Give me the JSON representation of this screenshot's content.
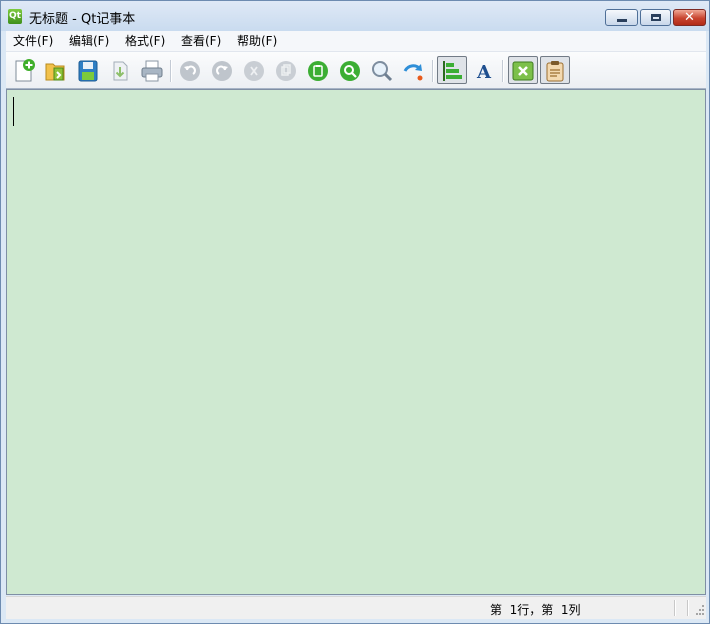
{
  "window": {
    "title": "无标题 - Qt记事本",
    "app_icon_letter": "Qt",
    "buttons": {
      "minimize": "minimize-icon",
      "maximize": "maximize-icon",
      "close": "close-icon",
      "close_glyph": "✕"
    }
  },
  "menu": {
    "items": [
      "文件(F)",
      "编辑(F)",
      "格式(F)",
      "查看(F)",
      "帮助(F)"
    ]
  },
  "toolbar": {
    "icons": [
      "new-file-icon",
      "open-file-icon",
      "save-icon",
      "save-as-icon",
      "print-icon",
      "undo-icon",
      "redo-icon",
      "cut-icon",
      "copy-icon",
      "paste-icon",
      "find-icon",
      "zoom-icon",
      "goto-icon",
      "align-toggle-icon",
      "font-icon",
      "theme-toggle-icon",
      "clipboard-icon"
    ],
    "checked": [
      "align-toggle-icon",
      "theme-toggle-icon",
      "clipboard-icon"
    ]
  },
  "editor": {
    "content": "",
    "background": "#cfe9d1"
  },
  "status": {
    "position": "第  1行，第  1列"
  },
  "colors": {
    "title_bar": "#c9dbef",
    "close_button": "#c8442f",
    "accent_green": "#3e8f1b"
  }
}
